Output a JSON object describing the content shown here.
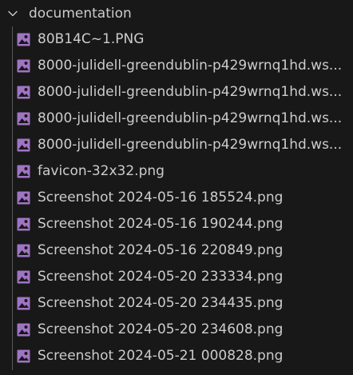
{
  "explorer": {
    "folder": {
      "name": "documentation",
      "expanded": true,
      "icon": "chevron-down-icon"
    },
    "file_icon": "image-file-icon",
    "colors": {
      "background": "#181818",
      "text": "#cccccc",
      "icon": "#a074c4",
      "guide": "#585858"
    },
    "files": [
      {
        "name": "80B14C~1.PNG"
      },
      {
        "name": "8000-julidell-greendublin-p429wrnq1hd.ws..."
      },
      {
        "name": "8000-julidell-greendublin-p429wrnq1hd.ws..."
      },
      {
        "name": "8000-julidell-greendublin-p429wrnq1hd.ws..."
      },
      {
        "name": "8000-julidell-greendublin-p429wrnq1hd.ws..."
      },
      {
        "name": "favicon-32x32.png"
      },
      {
        "name": "Screenshot 2024-05-16 185524.png"
      },
      {
        "name": "Screenshot 2024-05-16 190244.png"
      },
      {
        "name": "Screenshot 2024-05-16 220849.png"
      },
      {
        "name": "Screenshot 2024-05-20 233334.png"
      },
      {
        "name": "Screenshot 2024-05-20 234435.png"
      },
      {
        "name": "Screenshot 2024-05-20 234608.png"
      },
      {
        "name": "Screenshot 2024-05-21 000828.png"
      }
    ]
  }
}
